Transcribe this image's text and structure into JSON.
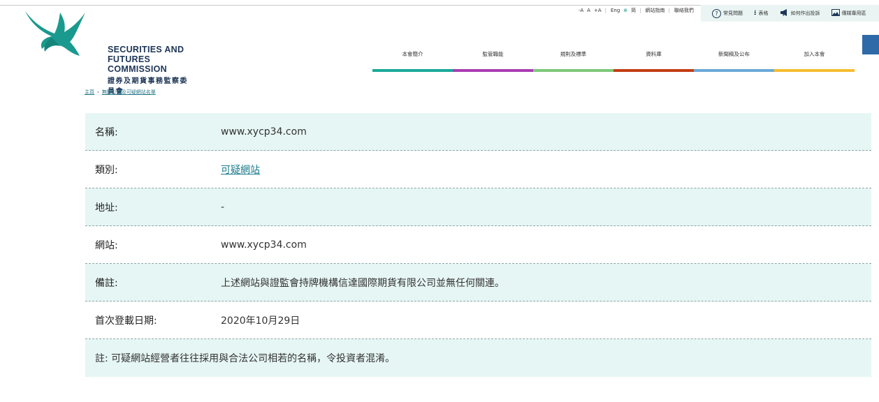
{
  "logo": {
    "line1": "SECURITIES AND",
    "line2": "FUTURES COMMISSION",
    "chinese": "證券及期貨事務監察委員會",
    "color": "#1a9a8e"
  },
  "util_links": {
    "font_minus": "-A",
    "font_normal": "A",
    "font_plus": "+A",
    "lang_en": "Eng",
    "lang_sc": "简",
    "sitemap": "網站指南",
    "contact": "聯絡我們"
  },
  "quick_links": [
    {
      "icon": "question-icon",
      "glyph": "?",
      "label": "常見問題"
    },
    {
      "icon": "download-icon",
      "glyph": "⭳",
      "label": "表格"
    },
    {
      "icon": "megaphone-icon",
      "glyph": "📢",
      "label": "如何作出投訴"
    },
    {
      "icon": "image-icon",
      "glyph": "🖼",
      "label": "傳媒專用區"
    }
  ],
  "nav": [
    {
      "label": "本會簡介",
      "color": "#1aa99a"
    },
    {
      "label": "監管職能",
      "color": "#a93db3"
    },
    {
      "label": "規則及標準",
      "color": "#7dc87a"
    },
    {
      "label": "資料庫",
      "color": "#c43d14"
    },
    {
      "label": "新聞稿及公布",
      "color": "#6aa9d8"
    },
    {
      "label": "加入本會",
      "color": "#f5bd2f"
    }
  ],
  "breadcrumb": {
    "home": "主頁",
    "current": "無牌公司及可疑網站名單"
  },
  "details": {
    "name_label": "名稱:",
    "name_value": "www.xycp34.com",
    "category_label": "類別:",
    "category_value": "可疑網站",
    "address_label": "地址:",
    "address_value": "-",
    "website_label": "網站:",
    "website_value": "www.xycp34.com",
    "remarks_label": "備註:",
    "remarks_value": "上述網站與證監會持牌機構信達國際期貨有限公司並無任何關連。",
    "date_label": "首次登載日期:",
    "date_value": "2020年10月29日",
    "note": "註: 可疑網站經營者往往採用與合法公司相若的名稱，令投資者混淆。"
  }
}
